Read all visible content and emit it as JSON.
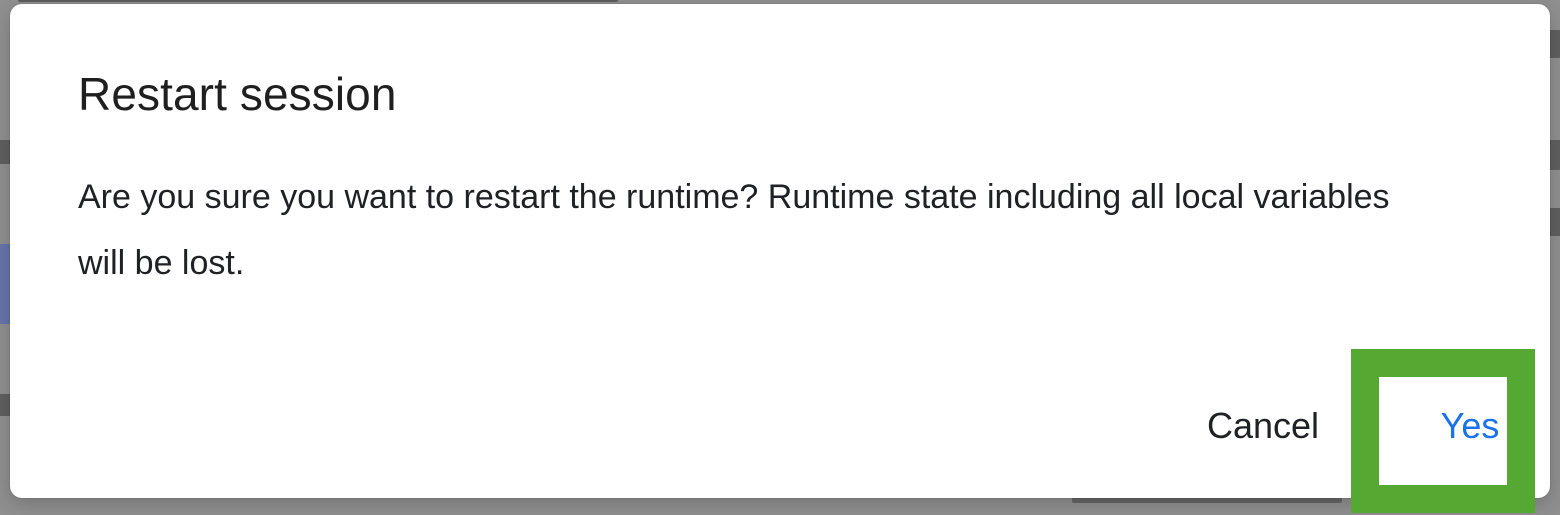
{
  "dialog": {
    "title": "Restart session",
    "message": "Are you sure you want to restart the runtime? Runtime state including all local variables will be lost.",
    "buttons": {
      "cancel": "Cancel",
      "yes": "Yes"
    }
  },
  "colors": {
    "primary_button_text": "#1a73e8",
    "secondary_button_text": "#202124",
    "highlight_border": "#55a832",
    "dialog_background": "#ffffff",
    "scrim": "#8e8e8e"
  }
}
